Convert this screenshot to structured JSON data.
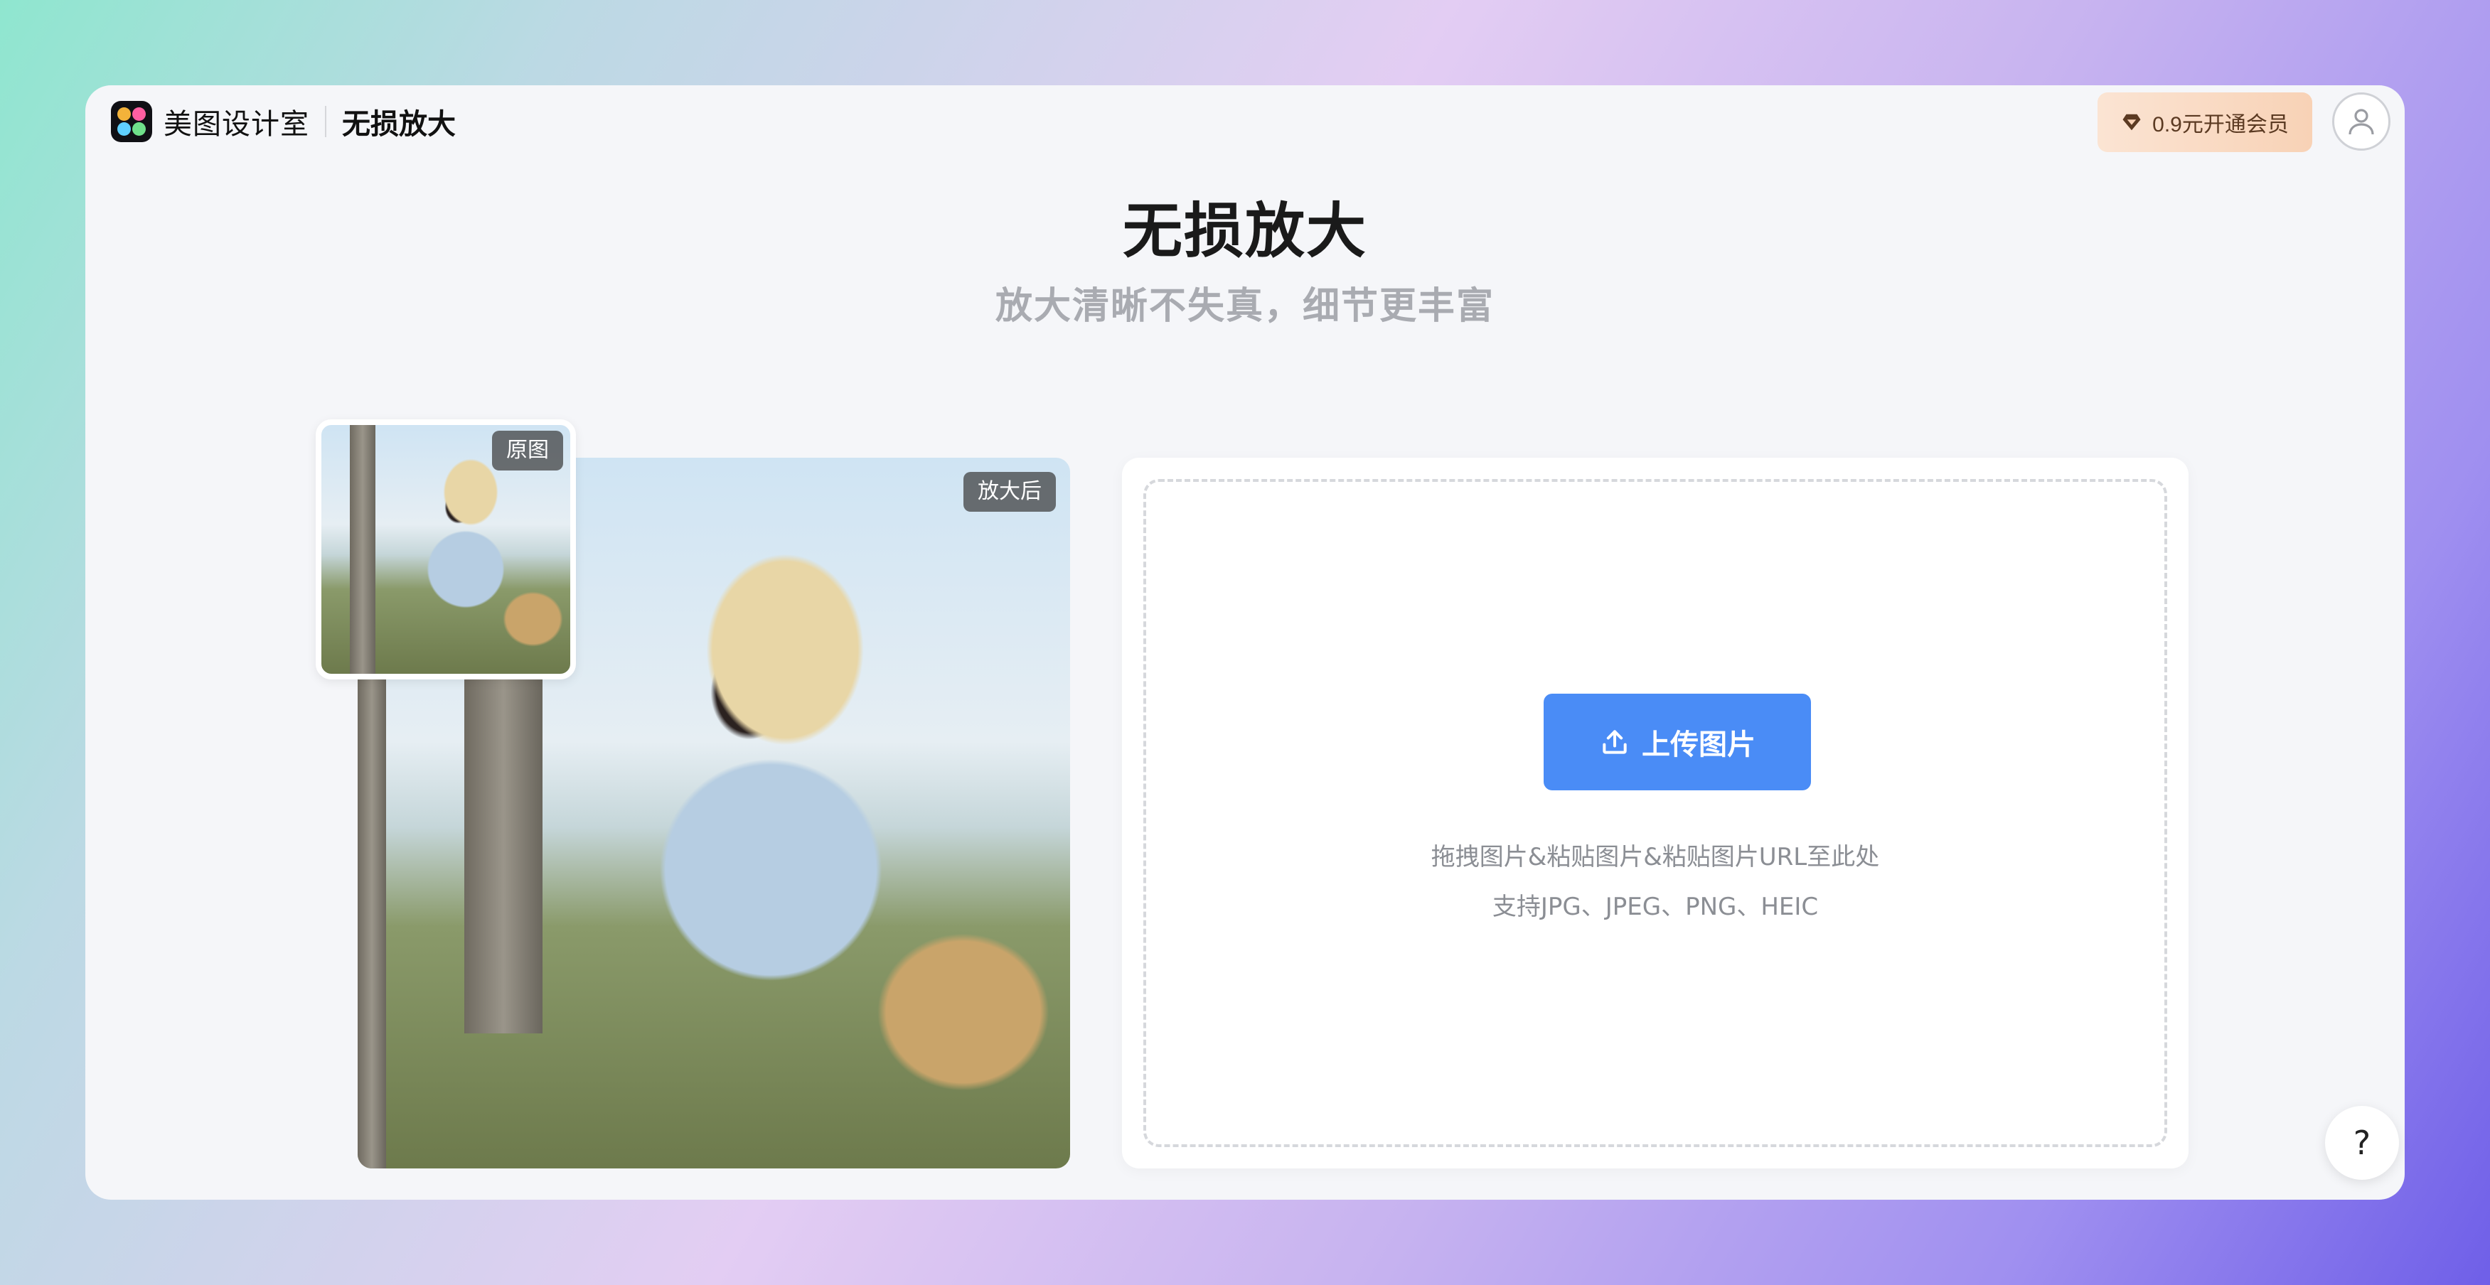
{
  "brand": {
    "name": "美图设计室",
    "page": "无损放大"
  },
  "header": {
    "vip_label": "0.9元开通会员"
  },
  "hero": {
    "title": "无损放大",
    "subtitle": "放大清晰不失真，细节更丰富"
  },
  "preview": {
    "original_tag": "原图",
    "enlarged_tag": "放大后"
  },
  "upload": {
    "button_label": "上传图片",
    "hint_drag": "拖拽图片&粘贴图片&粘贴图片URL至此处",
    "hint_formats": "支持JPG、JPEG、PNG、HEIC"
  },
  "help": {
    "label": "?"
  },
  "colors": {
    "accent": "#4a8cf6",
    "vip_bg": "#f8d2b6"
  },
  "icons": [
    "diamond-icon",
    "user-icon",
    "upload-icon"
  ]
}
